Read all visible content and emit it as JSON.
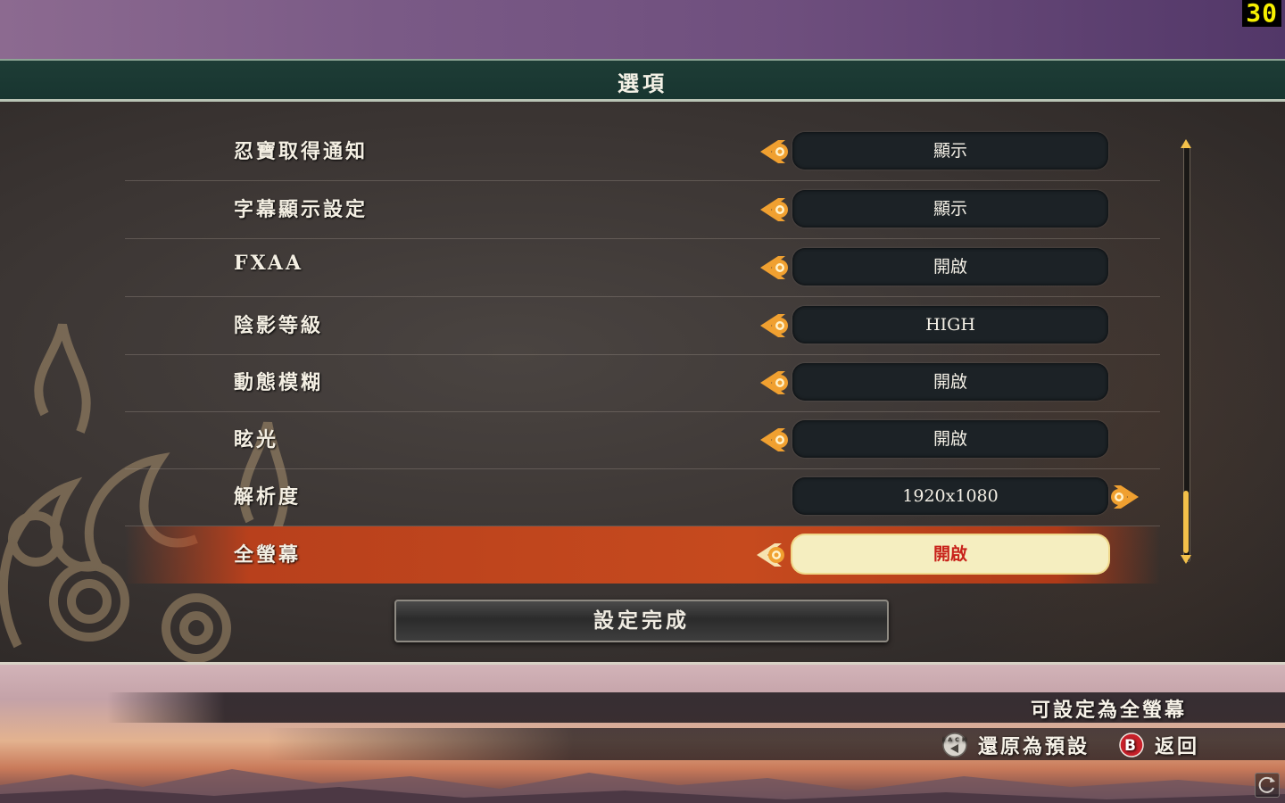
{
  "fps_counter": "30",
  "header": {
    "title": "選項"
  },
  "options": [
    {
      "label": "忍寶取得通知",
      "value": "顯示",
      "arrows": "left"
    },
    {
      "label": "字幕顯示設定",
      "value": "顯示",
      "arrows": "left"
    },
    {
      "label": "FXAA",
      "value": "開啟",
      "arrows": "left"
    },
    {
      "label": "陰影等級",
      "value": "HIGH",
      "arrows": "left"
    },
    {
      "label": "動態模糊",
      "value": "開啟",
      "arrows": "left"
    },
    {
      "label": "眩光",
      "value": "開啟",
      "arrows": "left"
    },
    {
      "label": "解析度",
      "value": "1920x1080",
      "arrows": "right"
    },
    {
      "label": "全螢幕",
      "value": "開啟",
      "arrows": "left",
      "selected": true
    }
  ],
  "buttons": {
    "done_label": "設定完成"
  },
  "footer": {
    "hint": "可設定為全螢幕",
    "reset": {
      "icon": "back-button-icon",
      "label": "還原為預設",
      "icon_text": "BACK"
    },
    "back": {
      "icon": "b-button-icon",
      "label": "返回",
      "icon_text": "B"
    }
  },
  "colors": {
    "accent_orange": "#f0a030",
    "selected_row": "#c64a1e",
    "header_bar": "#1e3d36",
    "b_button_red": "#c8202a"
  },
  "icons": {
    "corner": "refresh-icon"
  }
}
